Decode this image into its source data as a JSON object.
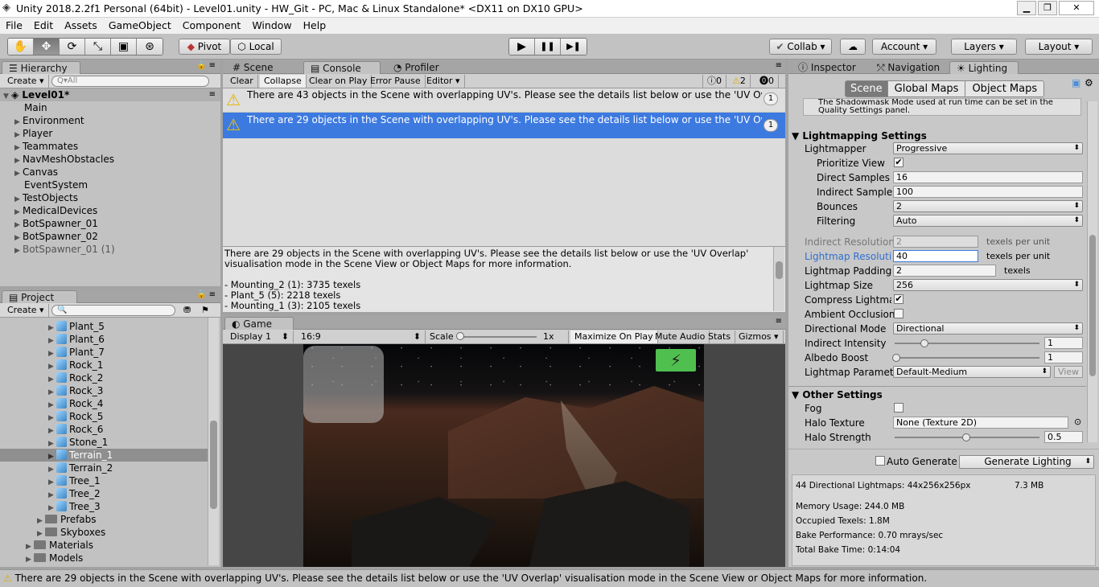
{
  "window": {
    "title": "Unity 2018.2.2f1 Personal (64bit) - Level01.unity - HW_Git - PC, Mac & Linux Standalone* <DX11 on DX10 GPU>",
    "btn_min": "▁",
    "btn_max": "❐",
    "btn_close": "✕"
  },
  "menu": [
    "File",
    "Edit",
    "Assets",
    "GameObject",
    "Component",
    "Window",
    "Help"
  ],
  "toolbar": {
    "pivot": "Pivot",
    "local": "Local",
    "collab": "Collab ▾",
    "account": "Account",
    "layers": "Layers",
    "layout": "Layout",
    "play": "▶",
    "pause": "❚❚",
    "step": "▶❚",
    "tools": [
      "✋",
      "✥",
      "⟳",
      "⤡",
      "▣",
      "⊛"
    ]
  },
  "hierarchy": {
    "tab": "Hierarchy",
    "create": "Create",
    "search_placeholder": "Q▾All",
    "scene": "Level01*",
    "items": [
      "Main",
      "Environment",
      "Player",
      "Teammates",
      "NavMeshObstacles",
      "Canvas",
      "EventSystem",
      "TestObjects",
      "MedicalDevices",
      "BotSpawner_01",
      "BotSpawner_02",
      "BotSpawner_01 (1)"
    ]
  },
  "project": {
    "tab": "Project",
    "create": "Create",
    "assets": [
      "Plant_5",
      "Plant_6",
      "Plant_7",
      "Rock_1",
      "Rock_2",
      "Rock_3",
      "Rock_4",
      "Rock_5",
      "Rock_6",
      "Stone_1",
      "Terrain_1",
      "Terrain_2",
      "Tree_1",
      "Tree_2",
      "Tree_3"
    ],
    "folders": [
      "Prefabs",
      "Skyboxes"
    ],
    "root_folders": [
      "Materials",
      "Models"
    ]
  },
  "console": {
    "tabs": [
      "Scene",
      "Console",
      "Profiler"
    ],
    "buttons": [
      "Clear",
      "Collapse",
      "Clear on Play",
      "Error Pause",
      "Editor"
    ],
    "counts": {
      "info": "0",
      "warn": "2",
      "error": "0"
    },
    "messages": [
      {
        "text": "There are 43 objects in the Scene with overlapping UV's. Please see the details list below or use the 'UV Overlap' vis",
        "count": "1"
      },
      {
        "text": "There are 29 objects in the Scene with overlapping UV's. Please see the details list below or use the 'UV Overlap' vis",
        "count": "1"
      }
    ],
    "detail": [
      "There are 29 objects in the Scene with overlapping UV's. Please see the details list below or use the 'UV Overlap'",
      "visualisation mode in the Scene View or Object Maps for more information.",
      "",
      "- Mounting_2 (1): 3735 texels",
      "- Plant_5 (5): 2218 texels",
      "- Mounting_1 (3): 2105 texels"
    ]
  },
  "game": {
    "tab": "Game",
    "display": "Display 1",
    "aspect": "16:9",
    "scale_label": "Scale",
    "scale_value": "1x",
    "buttons": [
      "Maximize On Play",
      "Mute Audio",
      "Stats",
      "Gizmos"
    ]
  },
  "inspector": {
    "tabs": [
      "Inspector",
      "Navigation",
      "Lighting"
    ],
    "subtabs": [
      "Scene",
      "Global Maps",
      "Object Maps"
    ],
    "note": "The Shadowmask Mode used at run time can be set in the Quality Settings panel.",
    "lightmapping": {
      "header": "Lightmapping Settings",
      "lightmapper_label": "Lightmapper",
      "lightmapper": "Progressive",
      "prioritize": "Prioritize View",
      "direct_label": "Direct Samples",
      "direct": "16",
      "indirect_label": "Indirect Samples",
      "indirect": "100",
      "bounces_label": "Bounces",
      "bounces": "2",
      "filtering_label": "Filtering",
      "filtering": "Auto",
      "indres_label": "Indirect Resolution",
      "indres": "2",
      "texels_per_unit": "texels per unit",
      "lmres_label": "Lightmap Resolution",
      "lmres": "40",
      "padding_label": "Lightmap Padding",
      "padding": "2",
      "texels": "texels",
      "size_label": "Lightmap Size",
      "size": "256",
      "compress": "Compress Lightmaps",
      "ao": "Ambient Occlusion",
      "dirmode_label": "Directional Mode",
      "dirmode": "Directional",
      "indint_label": "Indirect Intensity",
      "indint": "1",
      "albedo_label": "Albedo Boost",
      "albedo": "1",
      "params_label": "Lightmap Parameters",
      "params": "Default-Medium",
      "view": "View"
    },
    "other": {
      "header": "Other Settings",
      "fog": "Fog",
      "halo_label": "Halo Texture",
      "halo": "None (Texture 2D)",
      "halo_strength_label": "Halo Strength",
      "halo_strength": "0.5"
    },
    "auto_generate": "Auto Generate",
    "generate": "Generate Lighting",
    "stats": {
      "lightmaps": "44 Directional Lightmaps: 44x256x256px",
      "size": "7.3 MB",
      "memory": "Memory Usage: 244.0 MB",
      "texels": "Occupied Texels: 1.8M",
      "bake_perf": "Bake Performance: 0.70 mrays/sec",
      "bake_time": "Total Bake Time: 0:14:04"
    }
  },
  "status": "There are 29 objects in the Scene with overlapping UV's. Please see the details list below or use the 'UV Overlap' visualisation mode in the Scene View or Object Maps for more information.",
  "colors": {
    "selection": "#3d7ae0",
    "accent": "#4c8dd6"
  }
}
